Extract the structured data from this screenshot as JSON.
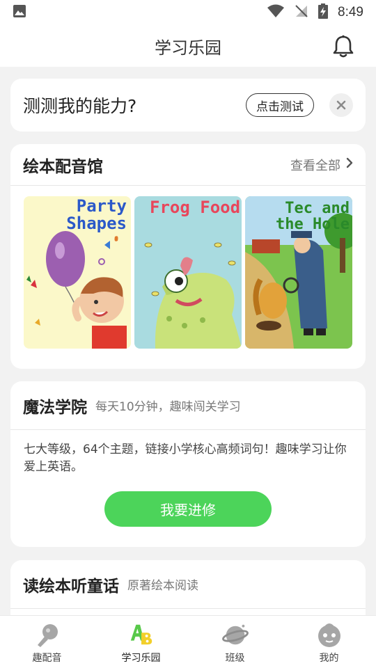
{
  "status_bar": {
    "time": "8:49",
    "icons": [
      "image-icon",
      "wifi-icon",
      "no-signal-icon",
      "battery-charging-icon"
    ]
  },
  "header": {
    "title": "学习乐园",
    "bell_icon": "bell-icon"
  },
  "ability_card": {
    "text": "测测我的能力?",
    "test_button": "点击测试",
    "close_icon": "close-icon"
  },
  "books_section": {
    "title": "绘本配音馆",
    "see_all": "查看全部",
    "books": [
      {
        "title_line1": "Party",
        "title_line2": "Shapes"
      },
      {
        "title_line1": "Frog Food",
        "title_line2": ""
      },
      {
        "title_line1": "Tec and",
        "title_line2": "the Hole"
      }
    ]
  },
  "magic_section": {
    "title": "魔法学院",
    "subtitle": "每天10分钟，趣味闯关学习",
    "description": "七大等级，64个主题，链接小学核心高频词句！趣味学习让你爱上英语。",
    "button": "我要进修"
  },
  "read_section": {
    "title": "读绘本听童话",
    "subtitle": "原著绘本阅读"
  },
  "bottom_nav": {
    "items": [
      {
        "label": "趣配音",
        "icon": "microphone-icon",
        "active": false
      },
      {
        "label": "学习乐园",
        "icon": "abc-icon",
        "active": true
      },
      {
        "label": "班级",
        "icon": "planet-icon",
        "active": false
      },
      {
        "label": "我的",
        "icon": "profile-face-icon",
        "active": false
      }
    ]
  },
  "colors": {
    "accent_green": "#4cd45a",
    "background": "#f2f2f2"
  }
}
